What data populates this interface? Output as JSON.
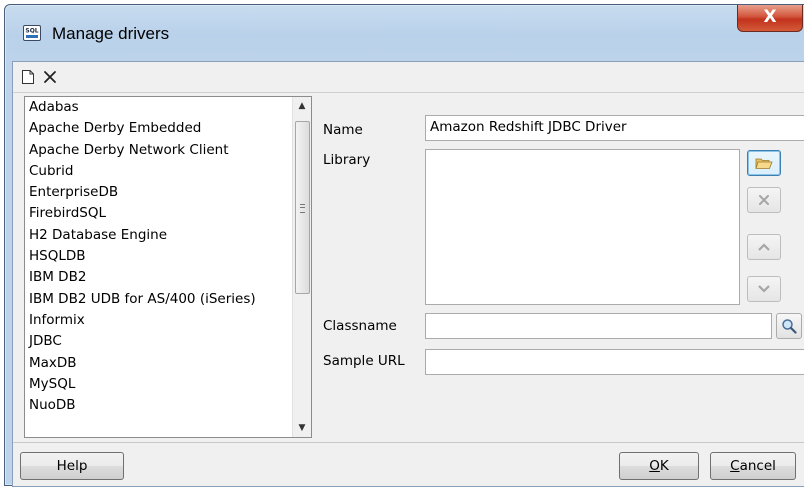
{
  "window": {
    "title": "Manage drivers",
    "app_icon_text": "SQL",
    "close_glyph": "X"
  },
  "toolbar": {
    "new_icon": "new-document-icon",
    "delete_icon": "delete-x-icon"
  },
  "drivers": [
    "Adabas",
    "Apache Derby Embedded",
    "Apache Derby Network Client",
    "Cubrid",
    "EnterpriseDB",
    "FirebirdSQL",
    "H2 Database Engine",
    "HSQLDB",
    "IBM DB2",
    "IBM DB2 UDB for AS/400 (iSeries)",
    "Informix",
    "JDBC",
    "MaxDB",
    "MySQL",
    "NuoDB"
  ],
  "form": {
    "name_label": "Name",
    "name_value": "Amazon Redshift JDBC Driver",
    "library_label": "Library",
    "classname_label": "Classname",
    "classname_value": "",
    "sample_url_label": "Sample URL",
    "sample_url_value": ""
  },
  "buttons": {
    "help": "Help",
    "ok_mnemonic": "O",
    "ok_rest": "K",
    "cancel_mnemonic": "C",
    "cancel_rest": "ancel"
  }
}
